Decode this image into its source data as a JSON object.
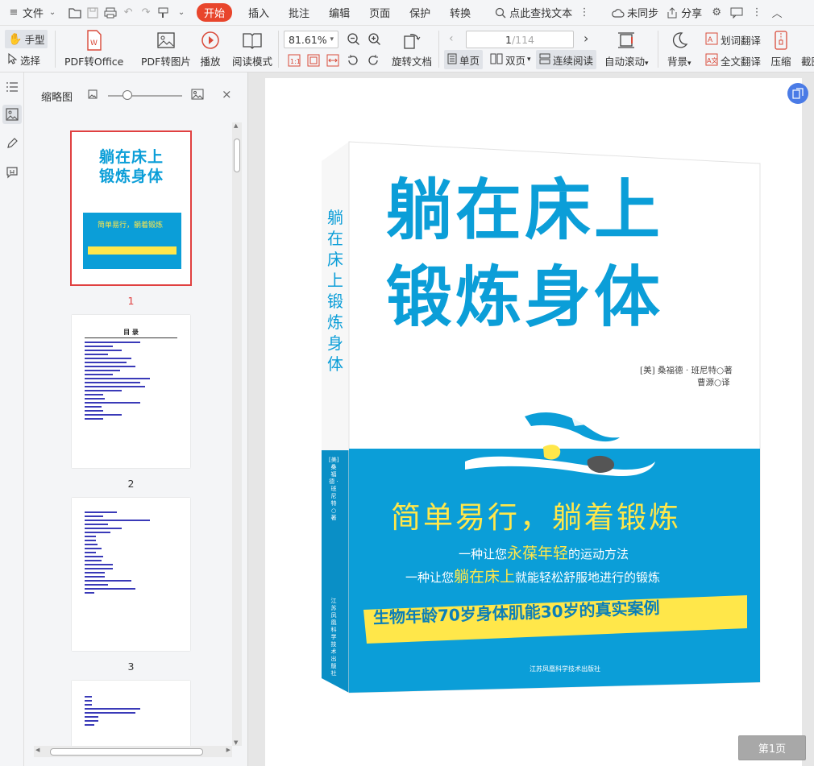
{
  "menubar": {
    "file": "文件",
    "start": "开始",
    "tabs": [
      "插入",
      "批注",
      "编辑",
      "页面",
      "保护",
      "转换"
    ],
    "search": "点此查找文本",
    "sync": "未同步",
    "share": "分享"
  },
  "toolbar": {
    "hand": "手型",
    "select": "选择",
    "pdf_to_office": "PDF转Office",
    "pdf_to_image": "PDF转图片",
    "play": "播放",
    "read_mode": "阅读模式",
    "zoom": "81.61%",
    "page_current": "1",
    "page_total": "/114",
    "rotate_doc": "旋转文档",
    "single_page": "单页",
    "double_page": "双页",
    "continuous": "连续阅读",
    "auto_scroll": "自动滚动",
    "background": "背景",
    "word_translate": "划词翻译",
    "full_translate": "全文翻译",
    "compress": "压缩",
    "screenshot": "截图"
  },
  "thumbnails": {
    "title": "缩略图",
    "pages": [
      "1",
      "2",
      "3"
    ]
  },
  "toc_thumb": {
    "heading": "目 录"
  },
  "cover": {
    "title_line1": "躺在床上",
    "title_line2": "锻炼身体",
    "spine_text": "躺在床上锻炼身体",
    "author": "[美] 桑福德 · 班尼特○著",
    "translator": "曹源○译",
    "slogan": "简单易行，躺着锻炼",
    "line1_prefix": "一种让您",
    "line1_highlight": "永葆年轻",
    "line1_suffix": "的运动方法",
    "line2_prefix": "一种让您",
    "line2_highlight": "躺在床上",
    "line2_suffix": "就能轻松舒服地进行的锻炼",
    "banner": "生物年龄70岁身体肌能30岁的真实案例",
    "publisher": "江苏凤凰科学技术出版社",
    "spine_author": "[美] 桑福德 · 班尼特○著"
  },
  "page_badge": "第1页",
  "colors": {
    "accent": "#e8452c",
    "cover_blue": "#0b9ed8",
    "cover_yellow": "#ffe74a",
    "selection_red": "#e04040"
  }
}
